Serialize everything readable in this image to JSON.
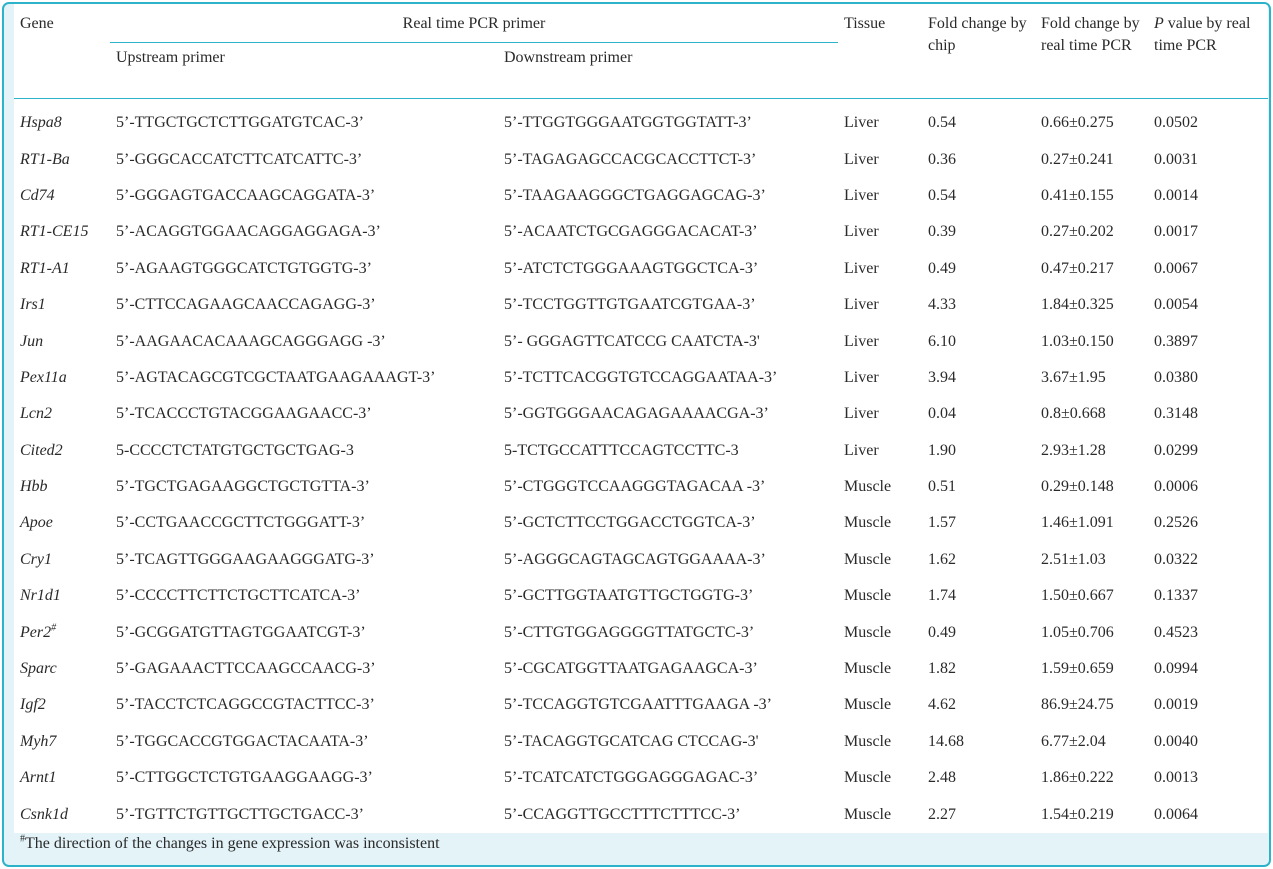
{
  "header": {
    "gene": "Gene",
    "primer_group": "Real time PCR primer",
    "upstream": "Upstream primer",
    "downstream": "Downstream primer",
    "tissue": "Tissue",
    "fold_chip": "Fold change by chip",
    "fold_pcr": "Fold change by real time PCR",
    "p_italic": "P",
    "p_rest": " value by real time PCR"
  },
  "rows": [
    {
      "gene": "Hspa8",
      "sup": "",
      "up": "5’-TTGCTGCTCTTGGATGTCAC-3’",
      "down": "5’-TTGGTGGGAATGGTGGTATT-3’",
      "tissue": "Liver",
      "chip": "0.54",
      "pcr": "0.66±0.275",
      "p": "0.0502"
    },
    {
      "gene": "RT1-Ba",
      "sup": "",
      "up": "5’-GGGCACCATCTTCATCATTC-3’",
      "down": "5’-TAGAGAGCCACGCACCTTCT-3’",
      "tissue": "Liver",
      "chip": "0.36",
      "pcr": "0.27±0.241",
      "p": "0.0031"
    },
    {
      "gene": "Cd74",
      "sup": "",
      "up": "5’-GGGAGTGACCAAGCAGGATA-3’",
      "down": "5’-TAAGAAGGGCTGAGGAGCAG-3’",
      "tissue": "Liver",
      "chip": "0.54",
      "pcr": "0.41±0.155",
      "p": "0.0014"
    },
    {
      "gene": "RT1-CE15",
      "sup": "",
      "up": "5’-ACAGGTGGAACAGGAGGAGA-3’",
      "down": "5’-ACAATCTGCGAGGGACACAT-3’",
      "tissue": "Liver",
      "chip": "0.39",
      "pcr": "0.27±0.202",
      "p": "0.0017"
    },
    {
      "gene": "RT1-A1",
      "sup": "",
      "up": "5’-AGAAGTGGGCATCTGTGGTG-3’",
      "down": "5’-ATCTCTGGGAAAGTGGCTCA-3’",
      "tissue": "Liver",
      "chip": "0.49",
      "pcr": "0.47±0.217",
      "p": "0.0067"
    },
    {
      "gene": "Irs1",
      "sup": "",
      "up": "5’-CTTCCAGAAGCAACCAGAGG-3’",
      "down": "5’-TCCTGGTTGTGAATCGTGAA-3’",
      "tissue": "Liver",
      "chip": "4.33",
      "pcr": "1.84±0.325",
      "p": "0.0054"
    },
    {
      "gene": "Jun",
      "sup": "",
      "up": "5’-AAGAACACAAAGCAGGGAGG -3’",
      "down": "5’- GGGAGTTCATCCG CAATCTA-3'",
      "tissue": "Liver",
      "chip": "6.10",
      "pcr": "1.03±0.150",
      "p": "0.3897"
    },
    {
      "gene": "Pex11a",
      "sup": "",
      "up": "5’-AGTACAGCGTCGCTAATGAAGAAAGT-3’",
      "down": "5’-TCTTCACGGTGTCCAGGAATAA-3’",
      "tissue": "Liver",
      "chip": "3.94",
      "pcr": "3.67±1.95",
      "p": "0.0380"
    },
    {
      "gene": "Lcn2",
      "sup": "",
      "up": "5’-TCACCCTGTACGGAAGAACC-3’",
      "down": "5’-GGTGGGAACAGAGAAAACGA-3’",
      "tissue": "Liver",
      "chip": "0.04",
      "pcr": "0.8±0.668",
      "p": "0.3148"
    },
    {
      "gene": "Cited2",
      "sup": "",
      "up": "5-CCCCTCTATGTGCTGCTGAG-3",
      "down": "5-TCTGCCATTTCCAGTCCTTC-3",
      "tissue": "Liver",
      "chip": "1.90",
      "pcr": "2.93±1.28",
      "p": "0.0299"
    },
    {
      "gene": "Hbb",
      "sup": "",
      "up": "5’-TGCTGAGAAGGCTGCTGTTA-3’",
      "down": "5’-CTGGGTCCAAGGGTAGACAA -3’",
      "tissue": "Muscle",
      "chip": "0.51",
      "pcr": "0.29±0.148",
      "p": "0.0006"
    },
    {
      "gene": "Apoe",
      "sup": "",
      "up": "5’-CCTGAACCGCTTCTGGGATT-3’",
      "down": "5’-GCTCTTCCTGGACCTGGTCA-3’",
      "tissue": "Muscle",
      "chip": "1.57",
      "pcr": "1.46±1.091",
      "p": "0.2526"
    },
    {
      "gene": "Cry1",
      "sup": "",
      "up": "5’-TCAGTTGGGAAGAAGGGATG-3’",
      "down": "5’-AGGGCAGTAGCAGTGGAAAA-3’",
      "tissue": "Muscle",
      "chip": "1.62",
      "pcr": "2.51±1.03",
      "p": "0.0322"
    },
    {
      "gene": "Nr1d1",
      "sup": "",
      "up": "5’-CCCCTTCTTCTGCTTCATCA-3’",
      "down": "5’-GCTTGGTAATGTTGCTGGTG-3’",
      "tissue": "Muscle",
      "chip": "1.74",
      "pcr": "1.50±0.667",
      "p": "0.1337"
    },
    {
      "gene": "Per2",
      "sup": "#",
      "up": "5’-GCGGATGTTAGTGGAATCGT-3’",
      "down": "5’-CTTGTGGAGGGGTTATGCTC-3’",
      "tissue": "Muscle",
      "chip": "0.49",
      "pcr": "1.05±0.706",
      "p": "0.4523"
    },
    {
      "gene": "Sparc",
      "sup": "",
      "up": "5’-GAGAAACTTCCAAGCCAACG-3’",
      "down": "5’-CGCATGGTTAATGAGAAGCA-3’",
      "tissue": "Muscle",
      "chip": "1.82",
      "pcr": "1.59±0.659",
      "p": "0.0994"
    },
    {
      "gene": "Igf2",
      "sup": "",
      "up": "5’-TACCTCTCAGGCCGTACTTCC-3’",
      "down": "5’-TCCAGGTGTCGAATTTGAAGA -3’",
      "tissue": "Muscle",
      "chip": "4.62",
      "pcr": "86.9±24.75",
      "p": "0.0019"
    },
    {
      "gene": "Myh7",
      "sup": "",
      "up": "5’-TGGCACCGTGGACTACAATA-3’",
      "down": "5’-TACAGGTGCATCAG CTCCAG-3'",
      "tissue": "Muscle",
      "chip": "14.68",
      "pcr": "6.77±2.04",
      "p": "0.0040"
    },
    {
      "gene": "Arnt1",
      "sup": "",
      "up": "5’-CTTGGCTCTGTGAAGGAAGG-3’",
      "down": "5’-TCATCATCTGGGAGGGAGAC-3’",
      "tissue": "Muscle",
      "chip": "2.48",
      "pcr": "1.86±0.222",
      "p": "0.0013"
    },
    {
      "gene": "Csnk1d",
      "sup": "",
      "up": "5’-TGTTCTGTTGCTTGCTGACC-3’",
      "down": "5’-CCAGGTTGCCTTTCTTTCC-3’",
      "tissue": "Muscle",
      "chip": "2.27",
      "pcr": "1.54±0.219",
      "p": "0.0064"
    }
  ],
  "footnote": {
    "mark": "#",
    "text": "The direction of the changes in gene expression was inconsistent"
  }
}
